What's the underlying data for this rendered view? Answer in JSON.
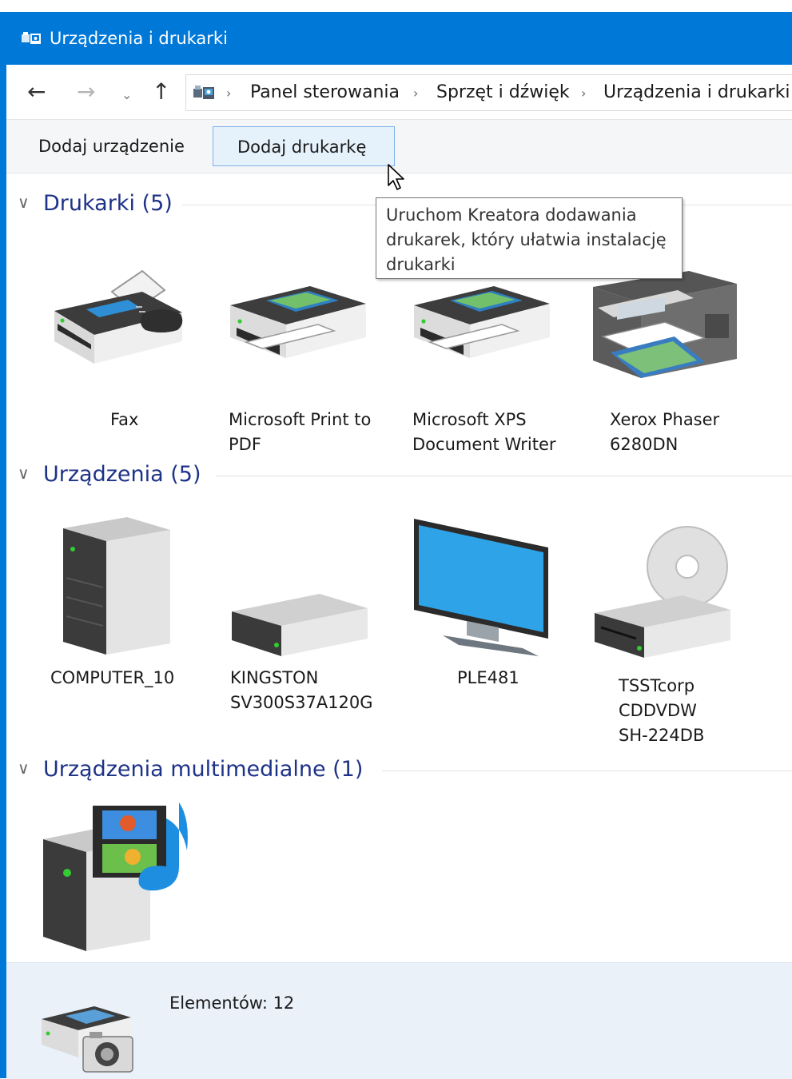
{
  "window": {
    "title": "Urządzenia i drukarki"
  },
  "address": {
    "crumbs": [
      "Panel sterowania",
      "Sprzęt i dźwięk",
      "Urządzenia i drukarki"
    ]
  },
  "toolbar": {
    "add_device": "Dodaj urządzenie",
    "add_printer": "Dodaj drukarkę"
  },
  "tooltip": {
    "line1": "Uruchom Kreatora dodawania",
    "line2": "drukarek, który ułatwia instalację",
    "line3": "drukarki"
  },
  "groups": {
    "printers": {
      "title": "Drukarki (5)",
      "items": [
        {
          "line1": "Fax",
          "line2": ""
        },
        {
          "line1": "Microsoft Print to",
          "line2": "PDF"
        },
        {
          "line1": "Microsoft XPS",
          "line2": "Document Writer"
        },
        {
          "line1": "Xerox Phaser",
          "line2": "6280DN"
        }
      ]
    },
    "devices": {
      "title": "Urządzenia (5)",
      "items": [
        {
          "line1": "COMPUTER_10",
          "line2": "",
          "line3": ""
        },
        {
          "line1": "KINGSTON",
          "line2": "SV300S37A120G",
          "line3": ""
        },
        {
          "line1": "PLE481",
          "line2": "",
          "line3": ""
        },
        {
          "line1": "TSSTcorp",
          "line2": "CDDVDW",
          "line3": "SH-224DB"
        }
      ]
    },
    "multimedia": {
      "title": "Urządzenia multimedialne (1)"
    }
  },
  "details": {
    "count": "Elementów: 12"
  },
  "icons": {
    "back": "back-arrow-icon",
    "forward": "forward-arrow-icon",
    "recent": "chevron-down-icon",
    "up": "up-arrow-icon"
  },
  "colors": {
    "titlebar": "#0078d7",
    "group_title": "#1e3287",
    "selected_button_bg": "#e5f1fb",
    "selected_button_border": "#7eb4ea",
    "details_bg": "#eaf1f9"
  }
}
